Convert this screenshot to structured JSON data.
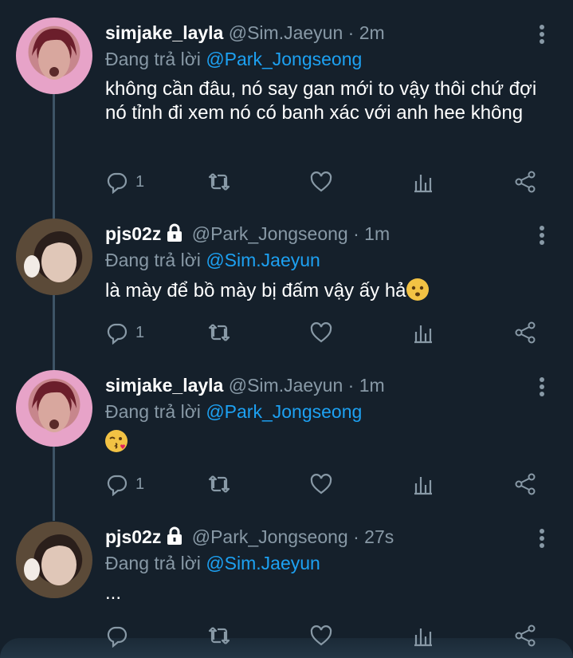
{
  "tweets": [
    {
      "display_name": "simjake_layla",
      "handle": "@Sim.Jaeyun",
      "time": "2m",
      "reply_prefix": "Đang trả lời",
      "reply_to": "@Park_Jongseong",
      "text": "không cần đâu, nó say gan mới to vậy thôi chứ đợi nó tỉnh đi xem nó có banh xác với anh hee không",
      "emoji": "",
      "reply_count": "1",
      "protected": false
    },
    {
      "display_name": "pjs02z",
      "handle": "@Park_Jongseong",
      "time": "1m",
      "reply_prefix": "Đang trả lời",
      "reply_to": "@Sim.Jaeyun",
      "text": "là mày để bồ mày bị đấm vậy ấy hả",
      "emoji": "worried-face",
      "reply_count": "1",
      "protected": true
    },
    {
      "display_name": "simjake_layla",
      "handle": "@Sim.Jaeyun",
      "time": "1m",
      "reply_prefix": "Đang trả lời",
      "reply_to": "@Park_Jongseong",
      "text": "",
      "emoji": "kissing-face",
      "reply_count": "1",
      "protected": false
    },
    {
      "display_name": "pjs02z",
      "handle": "@Park_Jongseong",
      "time": "27s",
      "reply_prefix": "Đang trả lời",
      "reply_to": "@Sim.Jaeyun",
      "text": "...",
      "emoji": "",
      "reply_count": "",
      "protected": true
    }
  ],
  "separator": "·",
  "colors": {
    "background": "#15202b",
    "text": "#ffffff",
    "secondary": "#8899a6",
    "mention": "#1da1f2"
  }
}
